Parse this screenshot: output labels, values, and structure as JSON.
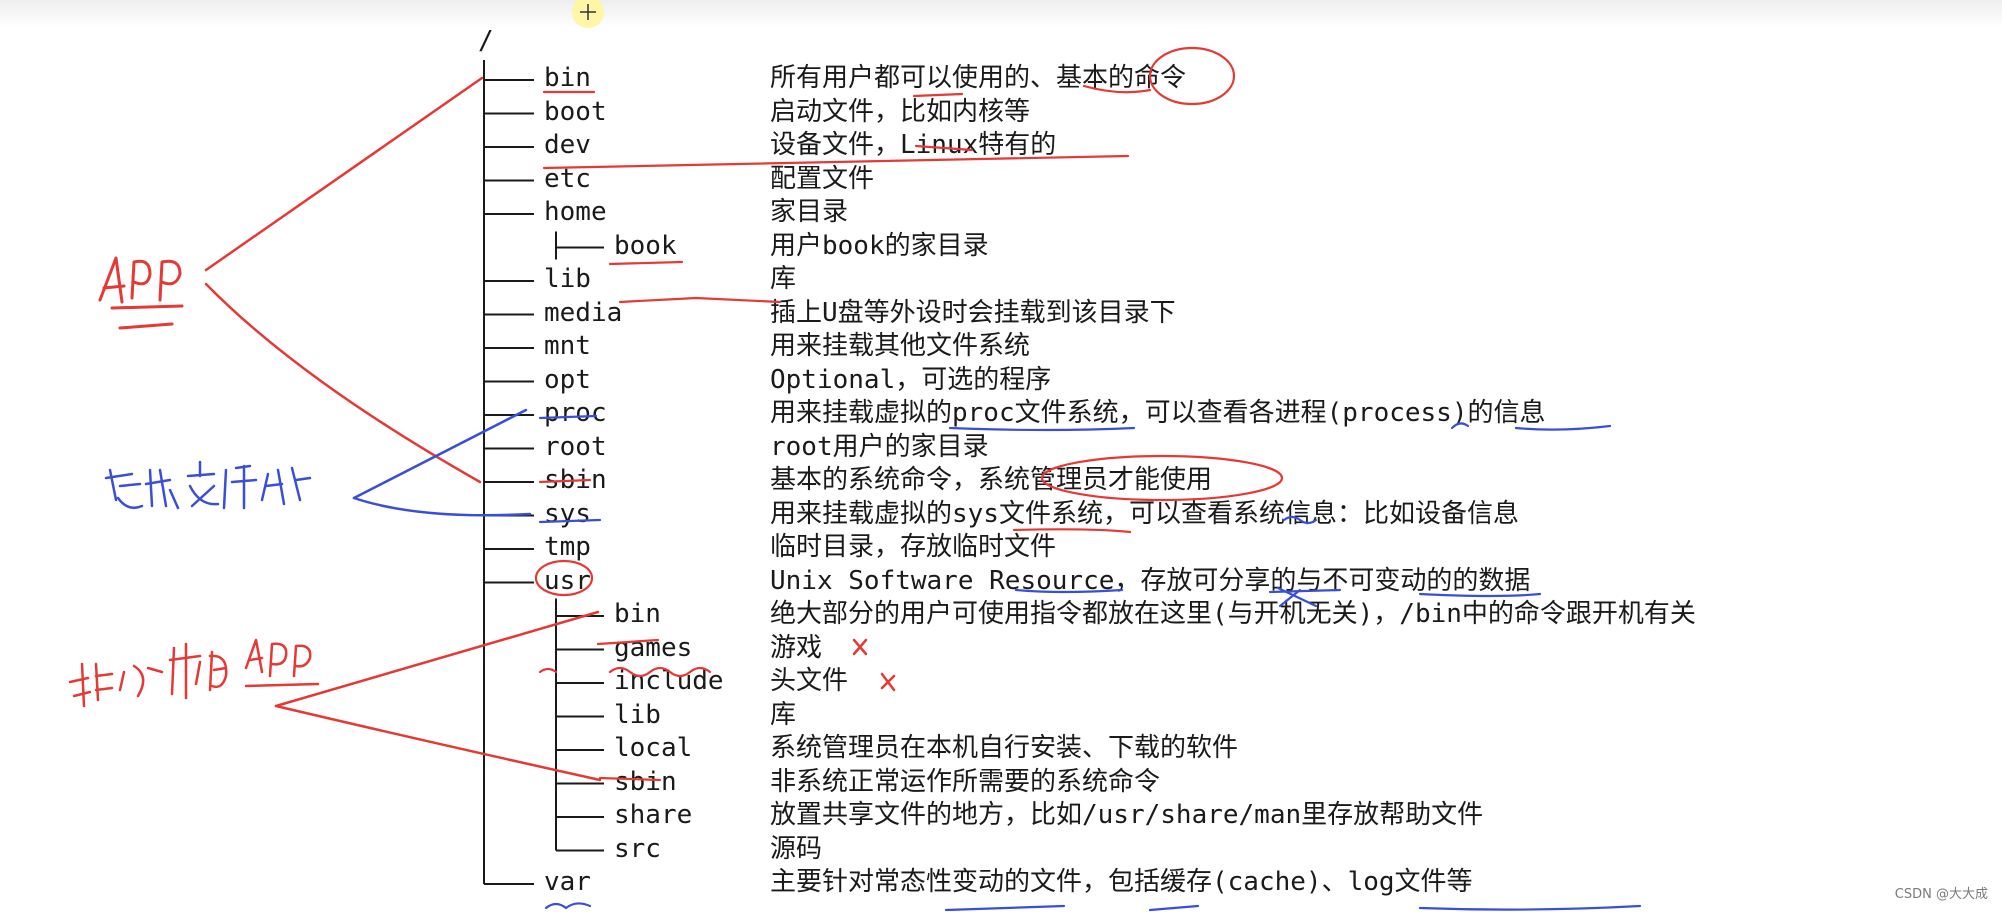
{
  "root_label": "/",
  "entries": [
    {
      "name": "bin",
      "desc": "所有用户都可以使用的、基本的命令"
    },
    {
      "name": "boot",
      "desc": "启动文件，比如内核等"
    },
    {
      "name": "dev",
      "desc": "设备文件，Linux特有的"
    },
    {
      "name": "etc",
      "desc": "配置文件"
    },
    {
      "name": "home",
      "desc": "家目录"
    },
    {
      "name": "book",
      "desc": "用户book的家目录"
    },
    {
      "name": "lib",
      "desc": "库"
    },
    {
      "name": "media",
      "desc": "插上U盘等外设时会挂载到该目录下"
    },
    {
      "name": "mnt",
      "desc": "用来挂载其他文件系统"
    },
    {
      "name": "opt",
      "desc": "Optional，可选的程序"
    },
    {
      "name": "proc",
      "desc": "用来挂载虚拟的proc文件系统，可以查看各进程(process)的信息"
    },
    {
      "name": "root",
      "desc": "root用户的家目录"
    },
    {
      "name": "sbin",
      "desc": "基本的系统命令，系统管理员才能使用"
    },
    {
      "name": "sys",
      "desc": "用来挂载虚拟的sys文件系统，可以查看系统信息：比如设备信息"
    },
    {
      "name": "tmp",
      "desc": "临时目录，存放临时文件"
    },
    {
      "name": "usr",
      "desc": "Unix Software Resource，存放可分享的与不可变动的的数据"
    },
    {
      "name": "bin",
      "desc": "绝大部分的用户可使用指令都放在这里(与开机无关)，/bin中的命令跟开机有关"
    },
    {
      "name": "games",
      "desc": "游戏"
    },
    {
      "name": "include",
      "desc": "头文件"
    },
    {
      "name": "lib",
      "desc": "库"
    },
    {
      "name": "local",
      "desc": "系统管理员在本机自行安装、下载的软件"
    },
    {
      "name": "sbin",
      "desc": "非系统正常运作所需要的系统命令"
    },
    {
      "name": "share",
      "desc": "放置共享文件的地方，比如/usr/share/man里存放帮助文件"
    },
    {
      "name": "src",
      "desc": "源码"
    },
    {
      "name": "var",
      "desc": "主要针对常态性变动的文件，包括缓存(cache)、log文件等"
    }
  ],
  "watermark": "CSDN @大大成",
  "colors": {
    "text": "#1a1a1a",
    "annotation_red": "#e53935",
    "annotation_blue": "#3a4fd6"
  }
}
